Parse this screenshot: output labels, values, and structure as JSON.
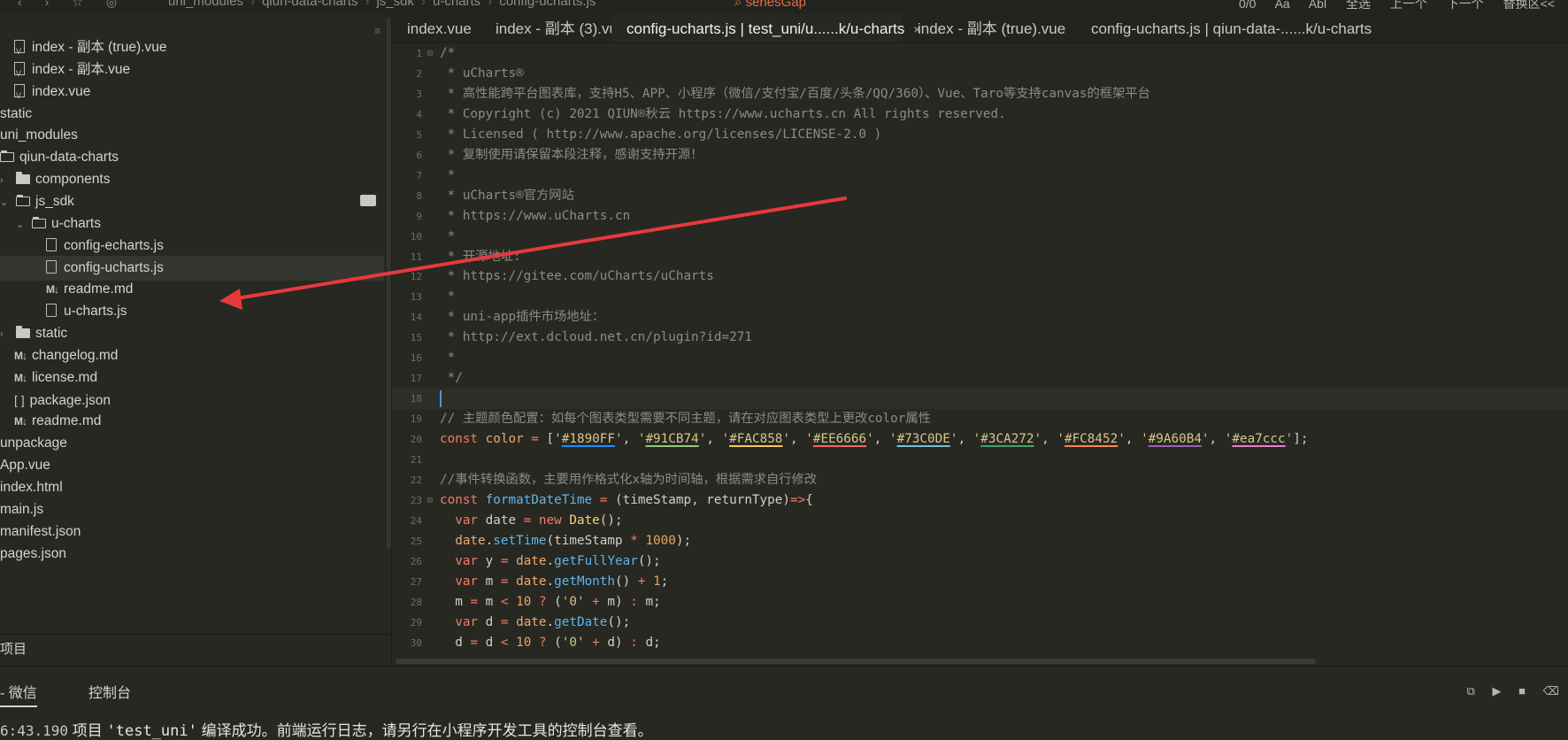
{
  "breadcrumb": [
    "uni_modules",
    "qiun-data-charts",
    "js_sdk",
    "u-charts",
    "config-ucharts.js"
  ],
  "find": {
    "term": "seriesGap",
    "match_count": "0/0",
    "opt_case": "Aa",
    "opt_word": "Abl",
    "btn_all": "全选",
    "btn_prev": "上一个",
    "btn_next": "下一个",
    "btn_replace": "替换区<<"
  },
  "sidebar": {
    "items": [
      {
        "label": "index - 副本 (true).vue",
        "icon": "vue-file-icon",
        "indent": 1
      },
      {
        "label": "index - 副本.vue",
        "icon": "vue-file-icon",
        "indent": 1
      },
      {
        "label": "index.vue",
        "icon": "vue-file-icon",
        "indent": 1
      },
      {
        "label": "static",
        "icon": "none",
        "indent": 0
      },
      {
        "label": "uni_modules",
        "icon": "none",
        "indent": 0
      },
      {
        "label": "qiun-data-charts",
        "icon": "folder-open-icon",
        "indent": 0
      },
      {
        "label": "components",
        "icon": "folder-icon",
        "indent": 1,
        "chevron": "›"
      },
      {
        "label": "js_sdk",
        "icon": "folder-open-icon",
        "indent": 1,
        "chevron": "⌄"
      },
      {
        "label": "u-charts",
        "icon": "folder-open-icon",
        "indent": 2,
        "chevron": "⌄"
      },
      {
        "label": "config-echarts.js",
        "icon": "js-file-icon",
        "indent": 3
      },
      {
        "label": "config-ucharts.js",
        "icon": "js-file-icon",
        "indent": 3,
        "selected": true
      },
      {
        "label": "readme.md",
        "icon": "markdown-icon",
        "indent": 3
      },
      {
        "label": "u-charts.js",
        "icon": "js-file-icon",
        "indent": 3
      },
      {
        "label": "static",
        "icon": "folder-icon",
        "indent": 1,
        "chevron": "›"
      },
      {
        "label": "changelog.md",
        "icon": "markdown-icon",
        "indent": 1
      },
      {
        "label": "license.md",
        "icon": "markdown-icon",
        "indent": 1
      },
      {
        "label": "package.json",
        "icon": "json-icon",
        "indent": 1
      },
      {
        "label": "readme.md",
        "icon": "markdown-icon",
        "indent": 1
      },
      {
        "label": "unpackage",
        "icon": "none",
        "indent": 0
      },
      {
        "label": "App.vue",
        "icon": "none",
        "indent": 0
      },
      {
        "label": "index.html",
        "icon": "none",
        "indent": 0
      },
      {
        "label": "main.js",
        "icon": "none",
        "indent": 0
      },
      {
        "label": "manifest.json",
        "icon": "none",
        "indent": 0
      },
      {
        "label": "pages.json",
        "icon": "none",
        "indent": 0
      }
    ],
    "project_label": "项目"
  },
  "tabs": [
    {
      "label": "index.vue"
    },
    {
      "label": "index - 副本 (3).vue"
    },
    {
      "label": "config-ucharts.js | test_uni/u......k/u-charts",
      "active": true,
      "close": "×"
    },
    {
      "label": "index - 副本 (true).vue"
    },
    {
      "label": "config-ucharts.js | qiun-data-......k/u-charts"
    }
  ],
  "editor": {
    "lines": [
      {
        "n": "1",
        "fold": "⊟",
        "parts": [
          [
            "c-com",
            "/*"
          ]
        ]
      },
      {
        "n": "2",
        "parts": [
          [
            "c-com",
            " * uCharts®"
          ]
        ]
      },
      {
        "n": "3",
        "parts": [
          [
            "c-com",
            " * 高性能跨平台图表库，支持H5、APP、小程序（微信/支付宝/百度/头条/QQ/360）、Vue、Taro等支持canvas的框架平台"
          ]
        ]
      },
      {
        "n": "4",
        "parts": [
          [
            "c-com",
            " * Copyright (c) 2021 QIUN®秋云 https://www.ucharts.cn All rights reserved."
          ]
        ]
      },
      {
        "n": "5",
        "parts": [
          [
            "c-com",
            " * Licensed ( http://www.apache.org/licenses/LICENSE-2.0 )"
          ]
        ]
      },
      {
        "n": "6",
        "parts": [
          [
            "c-com",
            " * 复制使用请保留本段注释，感谢支持开源！"
          ]
        ]
      },
      {
        "n": "7",
        "parts": [
          [
            "c-com",
            " * "
          ]
        ]
      },
      {
        "n": "8",
        "parts": [
          [
            "c-com",
            " * uCharts®官方网站"
          ]
        ]
      },
      {
        "n": "9",
        "parts": [
          [
            "c-com",
            " * https://www.uCharts.cn"
          ]
        ]
      },
      {
        "n": "10",
        "parts": [
          [
            "c-com",
            " * "
          ]
        ]
      },
      {
        "n": "11",
        "parts": [
          [
            "c-com",
            " * 开源地址:"
          ]
        ]
      },
      {
        "n": "12",
        "parts": [
          [
            "c-com",
            " * https://gitee.com/uCharts/uCharts"
          ]
        ]
      },
      {
        "n": "13",
        "parts": [
          [
            "c-com",
            " * "
          ]
        ]
      },
      {
        "n": "14",
        "parts": [
          [
            "c-com",
            " * uni-app插件市场地址："
          ]
        ]
      },
      {
        "n": "15",
        "parts": [
          [
            "c-com",
            " * http://ext.dcloud.net.cn/plugin?id=271"
          ]
        ]
      },
      {
        "n": "16",
        "parts": [
          [
            "c-com",
            " * "
          ]
        ]
      },
      {
        "n": "17",
        "parts": [
          [
            "c-com",
            " */"
          ]
        ]
      },
      {
        "n": "18",
        "current": true,
        "parts": []
      },
      {
        "n": "19",
        "parts": [
          [
            "c-com",
            "// 主题颜色配置：如每个图表类型需要不同主题，请在对应图表类型上更改color属性"
          ]
        ]
      },
      {
        "n": "20",
        "parts": [
          [
            "c-kw",
            "const "
          ],
          [
            "c-var",
            "color"
          ],
          [
            "c-op",
            " = "
          ],
          [
            "c-plain",
            "["
          ],
          [
            "c-str",
            "'"
          ],
          [
            "c-str hex:#1890FF",
            "#1890FF"
          ],
          [
            "c-str",
            "'"
          ],
          [
            "c-plain",
            ", "
          ],
          [
            "c-str",
            "'"
          ],
          [
            "c-str hex:#91CB74",
            "#91CB74"
          ],
          [
            "c-str",
            "'"
          ],
          [
            "c-plain",
            ", "
          ],
          [
            "c-str",
            "'"
          ],
          [
            "c-str hex:#FAC858",
            "#FAC858"
          ],
          [
            "c-str",
            "'"
          ],
          [
            "c-plain",
            ", "
          ],
          [
            "c-str",
            "'"
          ],
          [
            "c-str hex:#EE6666",
            "#EE6666"
          ],
          [
            "c-str",
            "'"
          ],
          [
            "c-plain",
            ", "
          ],
          [
            "c-str",
            "'"
          ],
          [
            "c-str hex:#73C0DE",
            "#73C0DE"
          ],
          [
            "c-str",
            "'"
          ],
          [
            "c-plain",
            ", "
          ],
          [
            "c-str",
            "'"
          ],
          [
            "c-str hex:#3CA272",
            "#3CA272"
          ],
          [
            "c-str",
            "'"
          ],
          [
            "c-plain",
            ", "
          ],
          [
            "c-str",
            "'"
          ],
          [
            "c-str hex:#FC8452",
            "#FC8452"
          ],
          [
            "c-str",
            "'"
          ],
          [
            "c-plain",
            ", "
          ],
          [
            "c-str",
            "'"
          ],
          [
            "c-str hex:#9A60B4",
            "#9A60B4"
          ],
          [
            "c-str",
            "'"
          ],
          [
            "c-plain",
            ", "
          ],
          [
            "c-str",
            "'"
          ],
          [
            "c-str hex:#ea7ccc",
            "#ea7ccc"
          ],
          [
            "c-str",
            "'"
          ],
          [
            "c-plain",
            "];"
          ]
        ]
      },
      {
        "n": "21",
        "parts": []
      },
      {
        "n": "22",
        "parts": [
          [
            "c-com",
            "//事件转换函数，主要用作格式化x轴为时间轴，根据需求自行修改"
          ]
        ]
      },
      {
        "n": "23",
        "fold": "⊟",
        "parts": [
          [
            "c-kw",
            "const "
          ],
          [
            "c-fn",
            "formatDateTime"
          ],
          [
            "c-op",
            " = "
          ],
          [
            "c-plain",
            "(timeStamp, returnType)"
          ],
          [
            "c-op",
            "=>"
          ],
          [
            "c-plain",
            "{"
          ]
        ]
      },
      {
        "n": "24",
        "parts": [
          [
            "c-plain",
            "  "
          ],
          [
            "c-kw",
            "var "
          ],
          [
            "c-plain",
            "date "
          ],
          [
            "c-op",
            "= "
          ],
          [
            "c-kw",
            "new "
          ],
          [
            "c-cls",
            "Date"
          ],
          [
            "c-plain",
            "();"
          ]
        ]
      },
      {
        "n": "25",
        "parts": [
          [
            "c-plain",
            "  "
          ],
          [
            "c-var",
            "date"
          ],
          [
            "c-plain",
            "."
          ],
          [
            "c-fn",
            "setTime"
          ],
          [
            "c-plain",
            "(timeStamp "
          ],
          [
            "c-op",
            "* "
          ],
          [
            "c-num",
            "1000"
          ],
          [
            "c-plain",
            ");"
          ]
        ]
      },
      {
        "n": "26",
        "parts": [
          [
            "c-plain",
            "  "
          ],
          [
            "c-kw",
            "var "
          ],
          [
            "c-plain",
            "y "
          ],
          [
            "c-op",
            "= "
          ],
          [
            "c-var",
            "date"
          ],
          [
            "c-plain",
            "."
          ],
          [
            "c-fn",
            "getFullYear"
          ],
          [
            "c-plain",
            "();"
          ]
        ]
      },
      {
        "n": "27",
        "parts": [
          [
            "c-plain",
            "  "
          ],
          [
            "c-kw",
            "var "
          ],
          [
            "c-plain",
            "m "
          ],
          [
            "c-op",
            "= "
          ],
          [
            "c-var",
            "date"
          ],
          [
            "c-plain",
            "."
          ],
          [
            "c-fn",
            "getMonth"
          ],
          [
            "c-plain",
            "() "
          ],
          [
            "c-op",
            "+ "
          ],
          [
            "c-num",
            "1"
          ],
          [
            "c-plain",
            ";"
          ]
        ]
      },
      {
        "n": "28",
        "parts": [
          [
            "c-plain",
            "  m "
          ],
          [
            "c-op",
            "= "
          ],
          [
            "c-plain",
            "m "
          ],
          [
            "c-op",
            "< "
          ],
          [
            "c-num",
            "10"
          ],
          [
            "c-op",
            " ? "
          ],
          [
            "c-plain",
            "("
          ],
          [
            "c-str",
            "'0'"
          ],
          [
            "c-op",
            " + "
          ],
          [
            "c-plain",
            "m) "
          ],
          [
            "c-op",
            ": "
          ],
          [
            "c-plain",
            "m;"
          ]
        ]
      },
      {
        "n": "29",
        "parts": [
          [
            "c-plain",
            "  "
          ],
          [
            "c-kw",
            "var "
          ],
          [
            "c-plain",
            "d "
          ],
          [
            "c-op",
            "= "
          ],
          [
            "c-var",
            "date"
          ],
          [
            "c-plain",
            "."
          ],
          [
            "c-fn",
            "getDate"
          ],
          [
            "c-plain",
            "();"
          ]
        ]
      },
      {
        "n": "30",
        "parts": [
          [
            "c-plain",
            "  d "
          ],
          [
            "c-op",
            "= "
          ],
          [
            "c-plain",
            "d "
          ],
          [
            "c-op",
            "< "
          ],
          [
            "c-num",
            "10"
          ],
          [
            "c-op",
            " ? "
          ],
          [
            "c-plain",
            "("
          ],
          [
            "c-str",
            "'0'"
          ],
          [
            "c-op",
            " + "
          ],
          [
            "c-plain",
            "d) "
          ],
          [
            "c-op",
            ": "
          ],
          [
            "c-plain",
            "d;"
          ]
        ]
      }
    ]
  },
  "panel": {
    "tabs": [
      {
        "label": "- 微信",
        "active": true
      },
      {
        "label": "控制台"
      }
    ],
    "log": {
      "time": "6:43.190",
      "prefix": " 项目 ",
      "project": "'test_uni'",
      "message": " 编译成功。前端运行日志，请另行在小程序开发工具的控制台查看。"
    }
  },
  "colors": {
    "background": "#272822",
    "annotation_arrow": "#e8393a",
    "cursor": "#4f8fe8"
  }
}
